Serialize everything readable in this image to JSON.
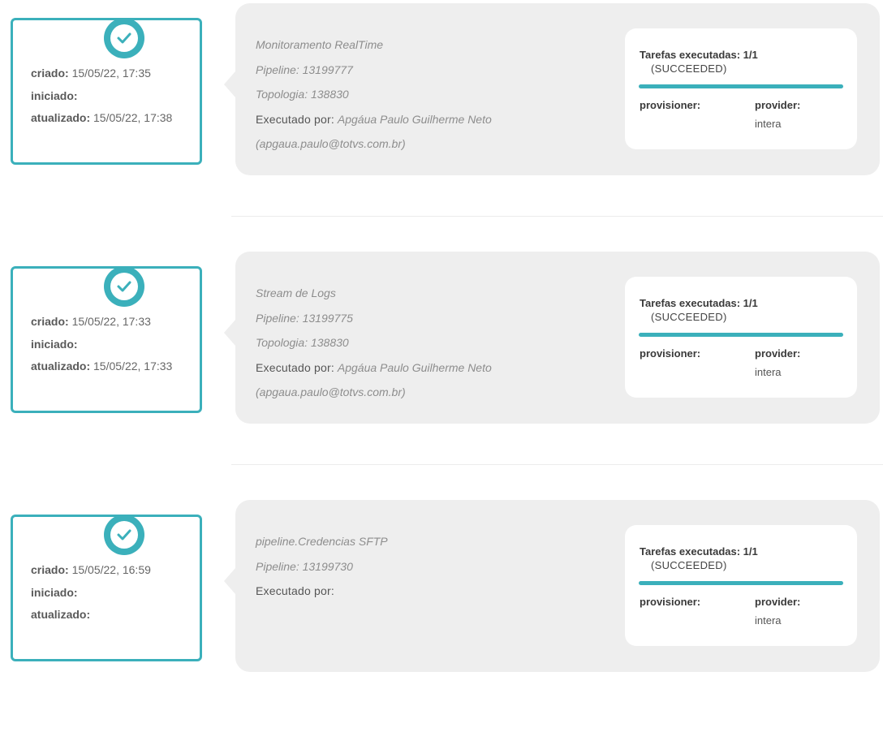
{
  "entries": [
    {
      "criado_label": "criado:",
      "criado": "15/05/22, 17:35",
      "iniciado_label": "iniciado:",
      "atualizado_label": "atualizado:",
      "atualizado": "15/05/22, 17:38",
      "name": "Monitoramento RealTime",
      "pipeline": "Pipeline: 13199777",
      "topologia": "Topologia: 138830",
      "executado_label": "Executado por:",
      "executado_por": "Apgáua Paulo Guilherme Neto",
      "email": "(apgaua.paulo@totvs.com.br)",
      "tarefas_label": "Tarefas executadas:",
      "tarefas": "1/1",
      "status": "(SUCCEEDED)",
      "progress": 1.0,
      "provisioner_label": "provisioner:",
      "provider_label": "provider:",
      "provider": "intera"
    },
    {
      "criado_label": "criado:",
      "criado": "15/05/22, 17:33",
      "iniciado_label": "iniciado:",
      "atualizado_label": "atualizado:",
      "atualizado": "15/05/22, 17:33",
      "name": "Stream de Logs",
      "pipeline": "Pipeline: 13199775",
      "topologia": "Topologia: 138830",
      "executado_label": "Executado por:",
      "executado_por": "Apgáua Paulo Guilherme Neto",
      "email": "(apgaua.paulo@totvs.com.br)",
      "tarefas_label": "Tarefas executadas:",
      "tarefas": "1/1",
      "status": "(SUCCEEDED)",
      "progress": 1.0,
      "provisioner_label": "provisioner:",
      "provider_label": "provider:",
      "provider": "intera"
    },
    {
      "criado_label": "criado:",
      "criado": "15/05/22, 16:59",
      "iniciado_label": "iniciado:",
      "atualizado_label": "atualizado:",
      "atualizado": "",
      "name": "pipeline.Credencias SFTP",
      "pipeline": "Pipeline: 13199730",
      "topologia": "",
      "executado_label": "Executado por:",
      "executado_por": "",
      "email": "",
      "tarefas_label": "Tarefas executadas:",
      "tarefas": "1/1",
      "status": "(SUCCEEDED)",
      "progress": 1.0,
      "provisioner_label": "provisioner:",
      "provider_label": "provider:",
      "provider": "intera"
    }
  ],
  "colors": {
    "accent": "#3bb0bb",
    "card_bg": "#eeeeee"
  },
  "icons": {
    "status": "check-circle-icon"
  }
}
